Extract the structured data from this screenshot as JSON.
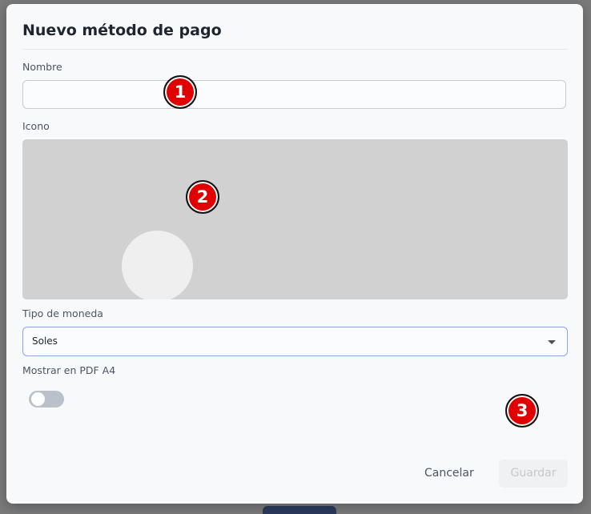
{
  "modal": {
    "title": "Nuevo método de pago",
    "name_label": "Nombre",
    "name_value": "",
    "icon_label": "Icono",
    "currency_label": "Tipo de moneda",
    "currency_value": "Soles",
    "pdf_label": "Mostrar en PDF A4",
    "pdf_toggle_on": false,
    "cancel_label": "Cancelar",
    "save_label": "Guardar"
  },
  "annotations": {
    "marker_1": "1",
    "marker_2": "2",
    "marker_3": "3"
  },
  "colors": {
    "marker": "#e00000",
    "select_border": "#8aa4e8",
    "modal_bg": "#f8f9fb"
  }
}
